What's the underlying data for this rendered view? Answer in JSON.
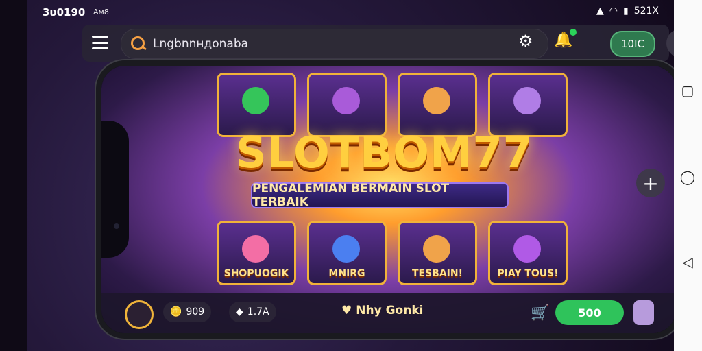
{
  "status_bar": {
    "time": "3υ0190",
    "carrier": "Aм8",
    "right_text": "521X"
  },
  "app_bar": {
    "search_value": "Lngbnnндonaba",
    "pill": "10IC"
  },
  "banner": {
    "title": "SLOTBOM77",
    "subtitle": "PENGALEMIAN BERMAIN SLOT TERBAIK"
  },
  "tiles": [
    "SHOPUOGIK",
    "MNIRG",
    "TESBAIN!",
    "PIAY TOUS!"
  ],
  "bottom_bar": {
    "coins": "909",
    "gems": "1.7A",
    "bonus": "Nhy Gonki",
    "action": "500"
  },
  "icons": [
    "menu-icon",
    "search-icon",
    "gear-icon",
    "bell-icon",
    "more-icon",
    "plus-icon",
    "cart-icon",
    "profile-icon"
  ]
}
